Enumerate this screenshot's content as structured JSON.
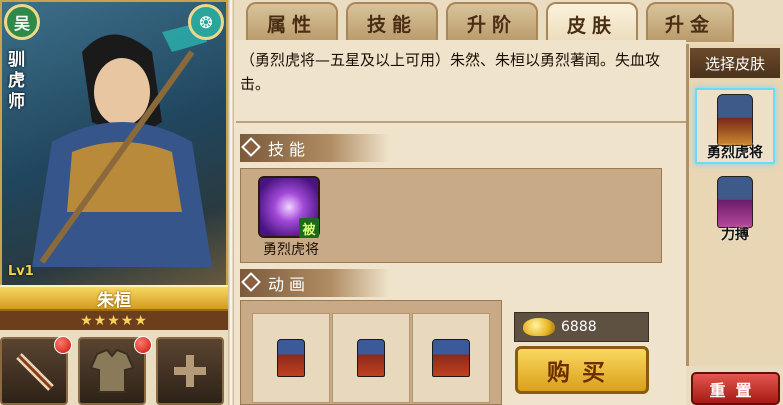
{
  "hero": {
    "faction": "吴",
    "title": "驯虎师",
    "level": "Lv1",
    "name": "朱桓",
    "stars": "★★★★★"
  },
  "tabs": [
    {
      "label": "属性",
      "active": false
    },
    {
      "label": "技能",
      "active": false
    },
    {
      "label": "升阶",
      "active": false
    },
    {
      "label": "皮肤",
      "active": true
    },
    {
      "label": "升金",
      "active": false
    }
  ],
  "skin_detail": {
    "description": "（勇烈虎将—五星及以上可用）朱然、朱桓以勇烈著闻。失血攻击。",
    "skill_section_title": "技能",
    "skill": {
      "name": "勇烈虎将",
      "tag": "被",
      "icon": "swirl-icon"
    },
    "animation_section_title": "动画"
  },
  "purchase": {
    "gold_amount": "6888",
    "buy_label": "购买"
  },
  "skin_list": {
    "header": "选择皮肤",
    "items": [
      {
        "label": "勇烈虎将",
        "selected": true
      },
      {
        "label": "力搏",
        "selected": false
      }
    ]
  },
  "reset_label": "重置",
  "colors": {
    "accent_gold": "#dba01a",
    "reset_red": "#c0231c",
    "tab_active": "#fbf2dc"
  }
}
